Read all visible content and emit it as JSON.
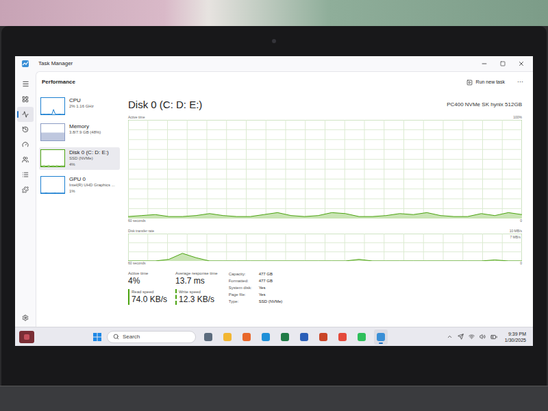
{
  "window": {
    "title": "Task Manager"
  },
  "nav": [
    {
      "selected": false
    },
    {
      "selected": true
    },
    {
      "selected": false
    },
    {
      "selected": false
    },
    {
      "selected": false
    },
    {
      "selected": false
    },
    {
      "selected": false
    }
  ],
  "header": {
    "title": "Performance",
    "action": "Run new task",
    "more": "···"
  },
  "resources": [
    {
      "name": "CPU",
      "detail": "2% 1.16 GHz",
      "value": "",
      "selected": false,
      "kind": "line",
      "color": "#1b7fd1",
      "series": [
        1,
        1,
        2,
        1,
        1,
        2,
        1,
        1,
        30,
        4,
        1,
        1,
        2,
        1,
        1,
        1
      ]
    },
    {
      "name": "Memory",
      "detail": "3.8/7.9 GB (48%)",
      "value": "",
      "selected": false,
      "kind": "fill",
      "color": "#8a9bc4",
      "level": 0.48
    },
    {
      "name": "Disk 0 (C: D: E:)",
      "detail": "SSD (NVMe)",
      "value": "4%",
      "selected": true,
      "kind": "line",
      "color": "#4aa30f",
      "series": [
        2,
        3,
        5,
        2,
        3,
        6,
        2,
        3,
        4,
        2,
        5,
        3,
        2,
        4,
        3,
        4
      ]
    },
    {
      "name": "GPU 0",
      "detail": "Intel(R) UHD Graphics ...",
      "value": "1%",
      "selected": false,
      "kind": "line",
      "color": "#1b7fd1",
      "series": [
        1,
        1,
        1,
        2,
        1,
        1,
        1,
        1,
        1,
        2,
        1,
        1,
        1,
        1,
        1,
        1
      ]
    }
  ],
  "disk": {
    "title": "Disk 0 (C: D: E:)",
    "model": "PC400 NVMe SK hynix 512GB"
  },
  "active_chart": {
    "label": "Active time",
    "max": "100%",
    "x_left": "60 seconds",
    "x_right": "0",
    "values": [
      2,
      3,
      4,
      2,
      2,
      3,
      5,
      3,
      2,
      2,
      4,
      6,
      3,
      2,
      3,
      6,
      5,
      2,
      2,
      3,
      5,
      4,
      6,
      3,
      2,
      2,
      5,
      3,
      6,
      4
    ]
  },
  "transfer_chart": {
    "label": "Disk transfer rate",
    "max": "10 MB/s",
    "marker": "7 MB/s",
    "x_left": "60 seconds",
    "x_right": "0",
    "values": [
      0,
      0,
      0,
      0.6,
      2.8,
      1.2,
      0,
      0,
      0,
      0,
      0,
      0,
      0,
      0,
      0,
      0,
      0,
      0.6,
      0,
      0,
      0,
      0,
      0,
      0,
      0,
      0,
      0,
      0.4,
      0,
      0
    ]
  },
  "stats": [
    {
      "label": "Active time",
      "value": "4%",
      "kind": "plain"
    },
    {
      "label": "Average response time",
      "value": "13.7 ms",
      "kind": "plain"
    },
    {
      "label": "Read speed",
      "value": "74.0 KB/s",
      "kind": "solid"
    },
    {
      "label": "Write speed",
      "value": "12.3 KB/s",
      "kind": "dashed"
    }
  ],
  "properties": [
    {
      "label": "Capacity:",
      "value": "477 GB"
    },
    {
      "label": "Formatted:",
      "value": "477 GB"
    },
    {
      "label": "System disk:",
      "value": "Yes"
    },
    {
      "label": "Page file:",
      "value": "Yes"
    },
    {
      "label": "Type:",
      "value": "SSD (NVMe)"
    }
  ],
  "taskbar": {
    "search": "Search",
    "time": "9:39 PM",
    "date": "1/30/2025",
    "apps": [
      {
        "color": "#5b6b7d",
        "active": false
      },
      {
        "color": "#f2b632",
        "active": false
      },
      {
        "color": "#e8672b",
        "active": false
      },
      {
        "color": "#1e8fd8",
        "active": false
      },
      {
        "color": "#1f7a45",
        "active": false
      },
      {
        "color": "#2b5fb8",
        "active": false
      },
      {
        "color": "#c94427",
        "active": false
      },
      {
        "color": "#e4493b",
        "active": false
      },
      {
        "color": "#2fbf5b",
        "active": false
      },
      {
        "color": "#3a8fd6",
        "active": true
      }
    ]
  }
}
